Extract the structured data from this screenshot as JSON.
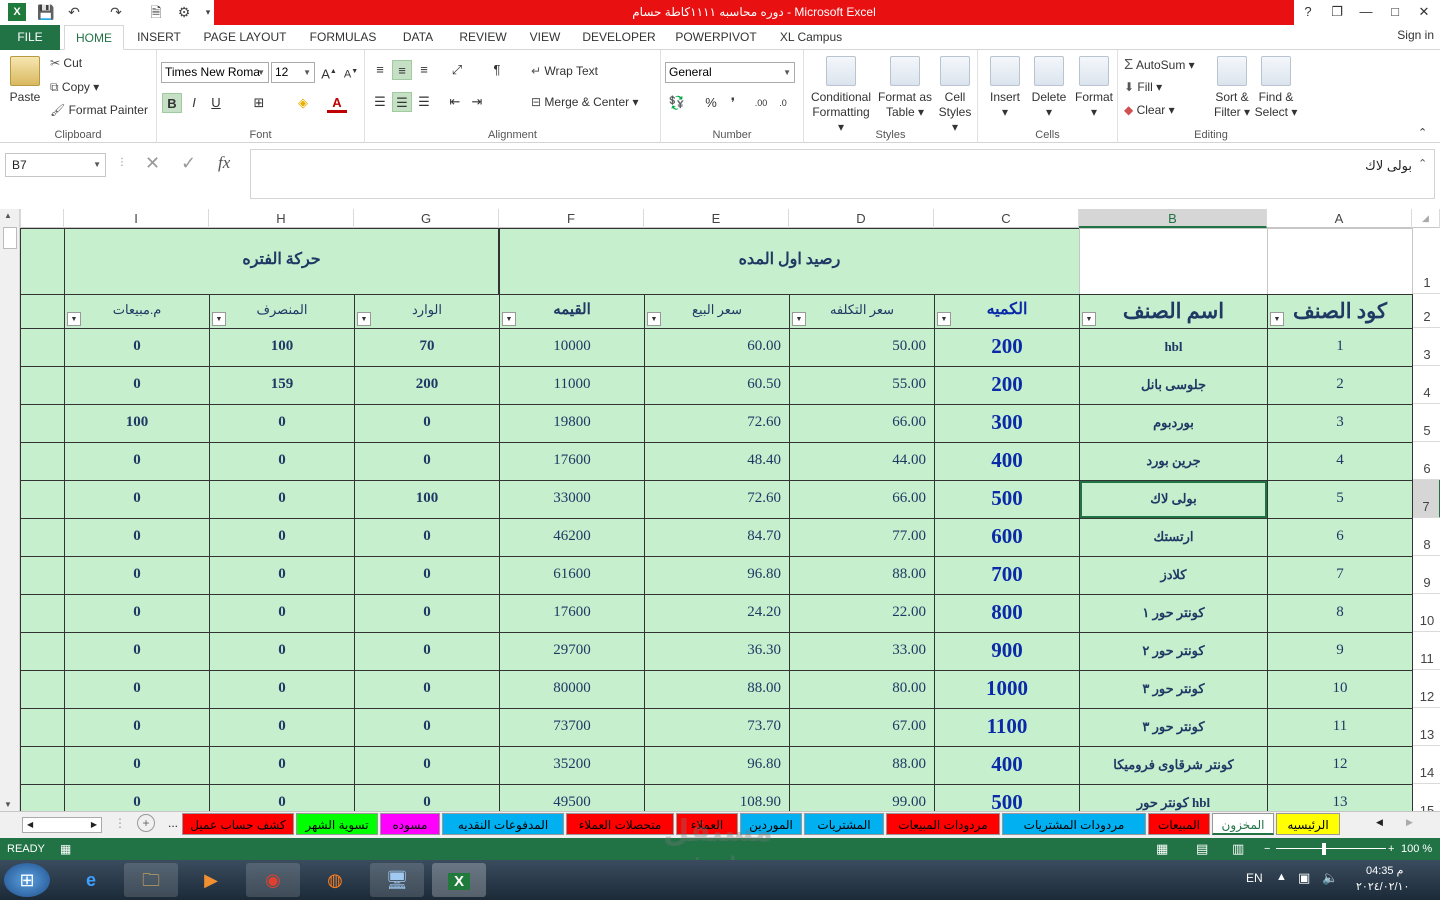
{
  "window": {
    "title": "دوره محاسبه ١١١١كاطة حسام  -  Microsoft Excel",
    "help": "?",
    "restore": "❐",
    "minimize": "—",
    "maximize": "□",
    "close": "✕"
  },
  "tabs": {
    "file": "FILE",
    "items": [
      "HOME",
      "INSERT",
      "PAGE LAYOUT",
      "FORMULAS",
      "DATA",
      "REVIEW",
      "VIEW",
      "DEVELOPER",
      "POWERPIVOT",
      "XL Campus"
    ],
    "signin": "Sign in"
  },
  "ribbon": {
    "clipboard": {
      "paste": "Paste",
      "cut": "Cut",
      "copy": "Copy",
      "format_painter": "Format Painter",
      "name": "Clipboard"
    },
    "font": {
      "family": "Times New Roma",
      "size": "12",
      "bold": "B",
      "italic": "I",
      "underline": "U",
      "name": "Font"
    },
    "alignment": {
      "wrap_text": "Wrap Text",
      "merge_center": "Merge & Center",
      "name": "Alignment"
    },
    "number": {
      "format": "General",
      "percent": "%",
      "comma": "❜",
      "name": "Number"
    },
    "styles": {
      "conditional": "Conditional",
      "conditional2": "Formatting",
      "format_as": "Format as",
      "format_as2": "Table",
      "cell": "Cell",
      "cell2": "Styles",
      "name": "Styles"
    },
    "cells": {
      "insert": "Insert",
      "delete": "Delete",
      "format": "Format",
      "name": "Cells"
    },
    "editing": {
      "autosum": "AutoSum",
      "fill": "Fill",
      "clear": "Clear",
      "sort": "Sort &",
      "sort2": "Filter",
      "find": "Find &",
      "find2": "Select",
      "name": "Editing"
    }
  },
  "formula_bar": {
    "name_box": "B7",
    "fx": "fx",
    "content": "بولى لاك"
  },
  "columns": [
    "I",
    "H",
    "G",
    "F",
    "E",
    "D",
    "C",
    "B",
    "A"
  ],
  "rows": [
    "1",
    "2",
    "3",
    "4",
    "5",
    "6",
    "7",
    "8",
    "9",
    "10",
    "11",
    "12",
    "13",
    "14",
    "15"
  ],
  "sheet": {
    "group_headers": {
      "period_movement": "حركة الفتره",
      "opening_balance": "رصيد اول المده"
    },
    "headers": {
      "item_code": "كود الصنف",
      "item_name": "اسم الصنف",
      "quantity": "الكميه",
      "cost_price": "سعر التكلفه",
      "sale_price": "سعر البيع",
      "value": "القيمه",
      "incoming": "الوارد",
      "outgoing": "المنصرف",
      "sales_returns": "م.مبيعات"
    },
    "data": [
      {
        "code": "1",
        "name": "hbl",
        "qty": "200",
        "cost": "50.00",
        "sale": "60.00",
        "value": "10000",
        "in": "70",
        "out": "100",
        "ret": "0"
      },
      {
        "code": "2",
        "name": "جلوسى بانل",
        "qty": "200",
        "cost": "55.00",
        "sale": "60.50",
        "value": "11000",
        "in": "200",
        "out": "159",
        "ret": "0"
      },
      {
        "code": "3",
        "name": "بوردبوم",
        "qty": "300",
        "cost": "66.00",
        "sale": "72.60",
        "value": "19800",
        "in": "0",
        "out": "0",
        "ret": "100"
      },
      {
        "code": "4",
        "name": "جرين بورد",
        "qty": "400",
        "cost": "44.00",
        "sale": "48.40",
        "value": "17600",
        "in": "0",
        "out": "0",
        "ret": "0"
      },
      {
        "code": "5",
        "name": "بولى لاك",
        "qty": "500",
        "cost": "66.00",
        "sale": "72.60",
        "value": "33000",
        "in": "100",
        "out": "0",
        "ret": "0"
      },
      {
        "code": "6",
        "name": "ارتستك",
        "qty": "600",
        "cost": "77.00",
        "sale": "84.70",
        "value": "46200",
        "in": "0",
        "out": "0",
        "ret": "0"
      },
      {
        "code": "7",
        "name": "كلادز",
        "qty": "700",
        "cost": "88.00",
        "sale": "96.80",
        "value": "61600",
        "in": "0",
        "out": "0",
        "ret": "0"
      },
      {
        "code": "8",
        "name": "كونتر حور ١",
        "qty": "800",
        "cost": "22.00",
        "sale": "24.20",
        "value": "17600",
        "in": "0",
        "out": "0",
        "ret": "0"
      },
      {
        "code": "9",
        "name": "كونتر حور ٢",
        "qty": "900",
        "cost": "33.00",
        "sale": "36.30",
        "value": "29700",
        "in": "0",
        "out": "0",
        "ret": "0"
      },
      {
        "code": "10",
        "name": "كونتر حور ٣",
        "qty": "1000",
        "cost": "80.00",
        "sale": "88.00",
        "value": "80000",
        "in": "0",
        "out": "0",
        "ret": "0"
      },
      {
        "code": "11",
        "name": "كونتر حور ٣",
        "qty": "1100",
        "cost": "67.00",
        "sale": "73.70",
        "value": "73700",
        "in": "0",
        "out": "0",
        "ret": "0"
      },
      {
        "code": "12",
        "name": "كونتر شرقاوى فروميكا",
        "qty": "400",
        "cost": "88.00",
        "sale": "96.80",
        "value": "35200",
        "in": "0",
        "out": "0",
        "ret": "0"
      },
      {
        "code": "13",
        "name": "كونتر حور hbl",
        "qty": "500",
        "cost": "99.00",
        "sale": "108.90",
        "value": "49500",
        "in": "0",
        "out": "0",
        "ret": "0"
      }
    ]
  },
  "sheet_tabs": [
    {
      "label": "الرئيسيه",
      "color": "#ffff00"
    },
    {
      "label": "المخزون",
      "color": "#ffffff"
    },
    {
      "label": "المبيعات",
      "color": "#ff0000"
    },
    {
      "label": "مردودات المشتريات",
      "color": "#00b0f0"
    },
    {
      "label": "مردودات المبيعات",
      "color": "#ff0000"
    },
    {
      "label": "المشتريات",
      "color": "#00b0f0"
    },
    {
      "label": "الموردين",
      "color": "#00b0f0"
    },
    {
      "label": "العملاء",
      "color": "#ff0000"
    },
    {
      "label": "متحصلات العملاء",
      "color": "#ff0000"
    },
    {
      "label": "المدفوعات النقديه",
      "color": "#00b0f0"
    },
    {
      "label": "مسوده",
      "color": "#ff00ff"
    },
    {
      "label": "تسوية الشهر",
      "color": "#00ff00"
    },
    {
      "label": "كشف حساب عميل",
      "color": "#ff0000"
    }
  ],
  "sheet_nav": {
    "more": "...",
    "add": "+"
  },
  "status": {
    "ready": "READY",
    "zoom": "100 %"
  },
  "taskbar": {
    "lang": "EN",
    "time": "04:35 م",
    "date": "٢٠٢٤/٠٢/١٠"
  },
  "watermark": {
    "ar": "مستقل",
    "en": "mostaql.com"
  }
}
